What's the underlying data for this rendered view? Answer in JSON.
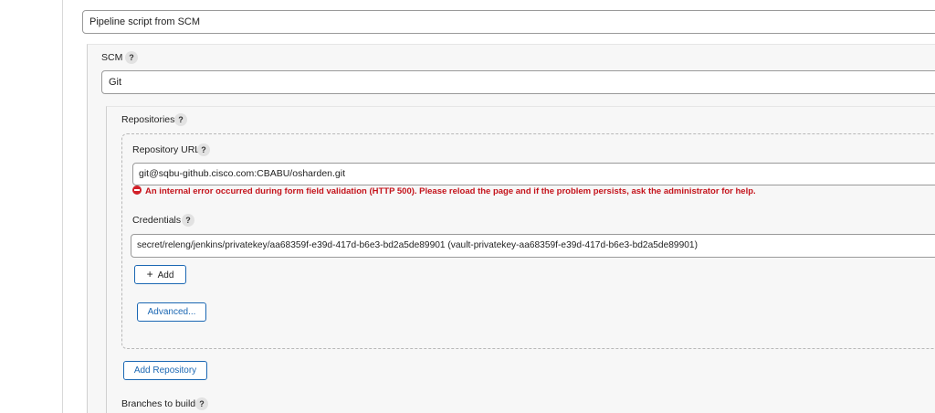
{
  "definition": {
    "selected_value": "Pipeline script from SCM"
  },
  "scm": {
    "label": "SCM",
    "help_glyph": "?",
    "selected_value": "Git"
  },
  "repositories": {
    "label": "Repositories",
    "help_glyph": "?",
    "repository_url": {
      "label": "Repository URL",
      "help_glyph": "?",
      "value": "git@sqbu-github.cisco.com:CBABU/osharden.git"
    },
    "error_message": "An internal error occurred during form field validation (HTTP 500). Please reload the page and if the problem persists, ask the administrator for help.",
    "credentials": {
      "label": "Credentials",
      "help_glyph": "?",
      "selected_value": "secret/releng/jenkins/privatekey/aa68359f-e39d-417d-b6e3-bd2a5de89901 (vault-privatekey-aa68359f-e39d-417d-b6e3-bd2a5de89901)",
      "add_button_plus": "+",
      "add_button_label": "Add"
    },
    "advanced_button_label": "Advanced...",
    "add_repository_button_label": "Add Repository"
  },
  "branches": {
    "label": "Branches to build",
    "help_glyph": "?"
  },
  "icons": {
    "help": "help-question-icon",
    "error": "error-no-entry-icon",
    "plus": "plus-icon"
  },
  "colors": {
    "error_red": "#c4131b",
    "link_blue": "#1b67b3",
    "panel_gray": "#f7f7f7",
    "border_gray": "#9a9a9a"
  }
}
